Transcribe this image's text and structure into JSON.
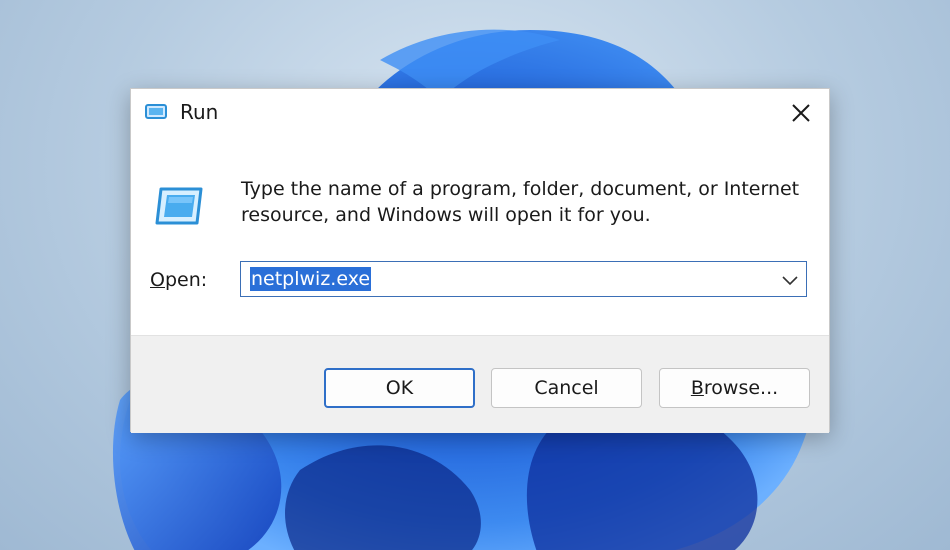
{
  "window": {
    "title": "Run",
    "icon": "run-icon",
    "close_icon": "close-icon"
  },
  "content": {
    "icon": "run-program-icon",
    "description": "Type the name of a program, folder, document, or Internet resource, and Windows will open it for you."
  },
  "open_field": {
    "label_accel": "O",
    "label_rest": "pen:",
    "value": "netplwiz.exe",
    "dropdown_icon": "chevron-down-icon"
  },
  "buttons": {
    "ok": "OK",
    "cancel": "Cancel",
    "browse_accel": "B",
    "browse_rest": "rowse..."
  },
  "colors": {
    "accent": "#2f6fc8",
    "selection": "#2a6fd8",
    "wallpaper_bloom": "#1f5fd8"
  }
}
